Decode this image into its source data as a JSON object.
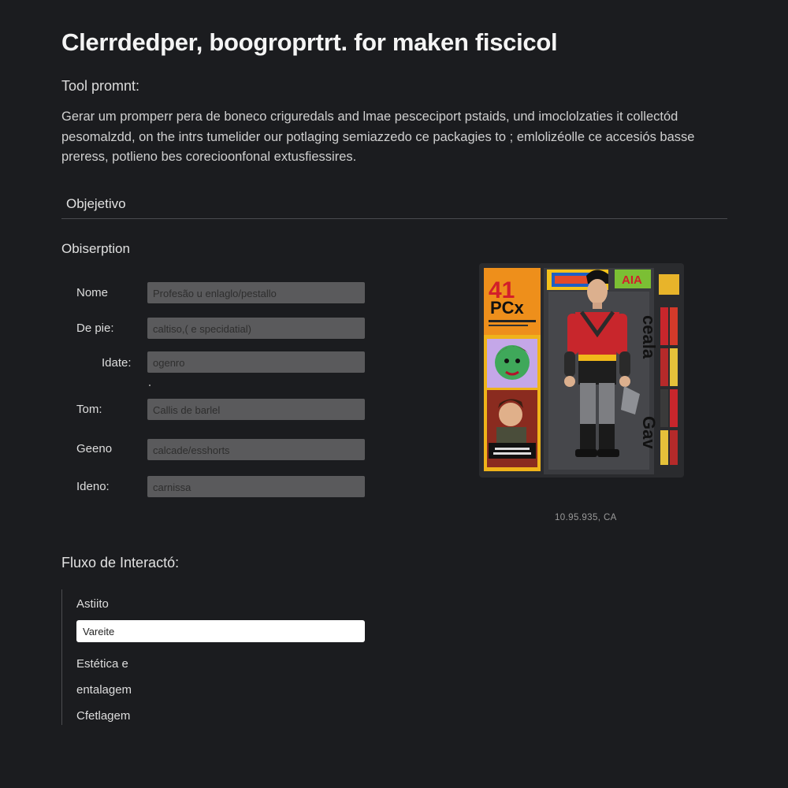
{
  "page": {
    "title": "Clerrdedper, boogroprtrt. for maken fiscicol",
    "tool_label": "Tool promnt:",
    "description": "Gerar um promperr pera de boneco criguredals and lmae pesceciport pstaids, und imoclolzaties it collectód pesomalzdd, on the intrs tumelider our potlaging semiazzedo ce packagies to ; emlolizéolle ce accesiós basse preress, potlieno bes corecioonfonal extusfiessires.",
    "section_heading": "Objejetivo",
    "subheading": "Obiserption"
  },
  "form": {
    "fields": [
      {
        "label": "Nome",
        "value": "Profesão u enlaglo/pestallo"
      },
      {
        "label": "De pie:",
        "value": "caltiso,( e specidatial)"
      },
      {
        "label": "Idate:",
        "value": "ogenro"
      },
      {
        "label": "Tom:",
        "value": "Callis de barlel"
      },
      {
        "label": "Geeno",
        "value": "calcade/esshorts"
      },
      {
        "label": "Ideno:",
        "value": "carnissa"
      }
    ]
  },
  "figure": {
    "package_number": "41",
    "package_brand": "PCx",
    "header_badge": "AIA",
    "side_text": "ceala",
    "side_text_bottom": "Gav",
    "caption": "10.95.935, CA"
  },
  "flow": {
    "heading": "Fluxo de Interactó:",
    "item1": "Astiito",
    "input_value": "Vareite",
    "item2": "Estética e",
    "item3": "entalagem",
    "item4": "Cfetlagem"
  },
  "colors": {
    "background": "#1b1c1f",
    "input_bg": "#5a5a5c",
    "figure_red": "#c8262c",
    "accent_yellow": "#f1b81a"
  }
}
